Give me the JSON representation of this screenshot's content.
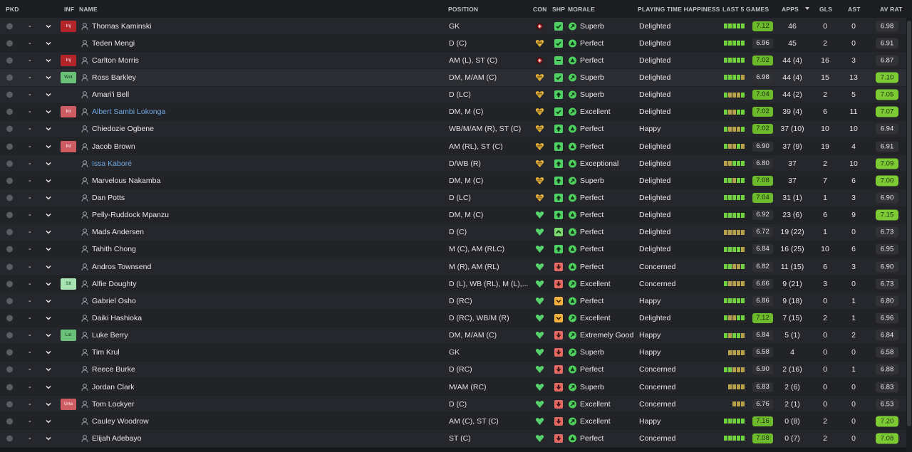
{
  "headers": {
    "pkd": "PKD",
    "inf": "INF",
    "name": "NAME",
    "position": "POSITION",
    "con": "CON",
    "shp": "SHP",
    "morale": "MORALE",
    "pth": "PLAYING TIME HAPPINESS",
    "last5": "LAST 5 GAMES",
    "apps": "APPS",
    "gls": "GLS",
    "ast": "AST",
    "avrat": "AV RAT"
  },
  "colors": {
    "last5_green": "#71d23f",
    "last5_olive": "#b7a04a",
    "last5_gray": "#666870",
    "rating_green": "#7ccb35",
    "con_heart": "#55d26b",
    "con_warn": "#e5b23c",
    "con_injury": "#d4363a"
  },
  "players": [
    {
      "pkd": "-",
      "inf": "Inj",
      "inf_style": "red",
      "name": "Thomas Kaminski",
      "name_style": "",
      "position": "GK",
      "con": "injury",
      "shp": "tick",
      "morale_icon": "arrow",
      "morale": "Superb",
      "pth": "Delighted",
      "last5": [
        "g",
        "g",
        "g",
        "g",
        "g"
      ],
      "avg": "7.12",
      "avg_style": "hi",
      "apps": "46",
      "gls": "0",
      "ast": "0",
      "avrat": "6.98",
      "avrat_style": "mid"
    },
    {
      "pkd": "-",
      "inf": "",
      "inf_style": "",
      "name": "Teden Mengi",
      "name_style": "",
      "position": "D (C)",
      "con": "warn",
      "shp": "tick",
      "morale_icon": "up",
      "morale": "Perfect",
      "pth": "Delighted",
      "last5": [
        "g",
        "g",
        "g",
        "g",
        "g"
      ],
      "avg": "6.96",
      "avg_style": "mid",
      "apps": "45",
      "gls": "2",
      "ast": "0",
      "avrat": "6.91",
      "avrat_style": "mid"
    },
    {
      "pkd": "-",
      "inf": "Inj",
      "inf_style": "red",
      "name": "Carlton Morris",
      "name_style": "",
      "position": "AM (L), ST (C)",
      "con": "injury",
      "shp": "dash",
      "morale_icon": "up",
      "morale": "Perfect",
      "pth": "Delighted",
      "last5": [
        "g",
        "g",
        "g",
        "g",
        "g"
      ],
      "avg": "7.02",
      "avg_style": "hi",
      "apps": "44 (4)",
      "gls": "16",
      "ast": "3",
      "avrat": "6.87",
      "avrat_style": "mid"
    },
    {
      "pkd": "-",
      "inf": "Wnt",
      "inf_style": "green",
      "name": "Ross Barkley",
      "name_style": "",
      "position": "DM, M/AM (C)",
      "con": "warn",
      "shp": "tick",
      "morale_icon": "arrow",
      "morale": "Superb",
      "pth": "Delighted",
      "last5": [
        "g",
        "g",
        "g",
        "g",
        "o"
      ],
      "avg": "6.98",
      "avg_style": "mid",
      "apps": "44 (4)",
      "gls": "15",
      "ast": "13",
      "avrat": "7.10",
      "avrat_style": "hi"
    },
    {
      "pkd": "-",
      "inf": "",
      "inf_style": "",
      "name": "Amari'i Bell",
      "name_style": "",
      "position": "D (LC)",
      "con": "warn",
      "shp": "up",
      "morale_icon": "arrow",
      "morale": "Superb",
      "pth": "Delighted",
      "last5": [
        "g",
        "o",
        "o",
        "o",
        "g"
      ],
      "avg": "7.04",
      "avg_style": "hi",
      "apps": "44 (2)",
      "gls": "2",
      "ast": "5",
      "avrat": "7.05",
      "avrat_style": "hi"
    },
    {
      "pkd": "-",
      "inf": "Int",
      "inf_style": "pink",
      "name": "Albert Sambi Lokonga",
      "name_style": "blue",
      "position": "DM, M (C)",
      "con": "warn",
      "shp": "tick",
      "morale_icon": "arrow",
      "morale": "Excellent",
      "pth": "Delighted",
      "last5": [
        "g",
        "o",
        "o",
        "g",
        "g"
      ],
      "avg": "7.02",
      "avg_style": "hi",
      "apps": "39 (4)",
      "gls": "6",
      "ast": "11",
      "avrat": "7.07",
      "avrat_style": "hi"
    },
    {
      "pkd": "-",
      "inf": "",
      "inf_style": "",
      "name": "Chiedozie Ogbene",
      "name_style": "",
      "position": "WB/M/AM (R), ST (C)",
      "con": "warn",
      "shp": "up",
      "morale_icon": "up",
      "morale": "Perfect",
      "pth": "Happy",
      "last5": [
        "g",
        "o",
        "o",
        "o",
        "g"
      ],
      "avg": "7.02",
      "avg_style": "hi",
      "apps": "37 (10)",
      "gls": "10",
      "ast": "10",
      "avrat": "6.94",
      "avrat_style": "mid"
    },
    {
      "pkd": "-",
      "inf": "Int",
      "inf_style": "pink",
      "name": "Jacob Brown",
      "name_style": "",
      "position": "AM (RL), ST (C)",
      "con": "warn",
      "shp": "up",
      "morale_icon": "up",
      "morale": "Perfect",
      "pth": "Delighted",
      "last5": [
        "g",
        "o",
        "o",
        "g",
        "o"
      ],
      "avg": "6.90",
      "avg_style": "mid",
      "apps": "37 (9)",
      "gls": "19",
      "ast": "4",
      "avrat": "6.91",
      "avrat_style": "mid"
    },
    {
      "pkd": "-",
      "inf": "",
      "inf_style": "",
      "name": "Issa Kaboré",
      "name_style": "blue",
      "position": "D/WB (R)",
      "con": "warn",
      "shp": "up",
      "morale_icon": "up",
      "morale": "Exceptional",
      "pth": "Delighted",
      "last5": [
        "o",
        "o",
        "g",
        "g",
        "g"
      ],
      "avg": "6.80",
      "avg_style": "mid",
      "apps": "37",
      "gls": "2",
      "ast": "10",
      "avrat": "7.09",
      "avrat_style": "hi"
    },
    {
      "pkd": "-",
      "inf": "",
      "inf_style": "",
      "name": "Marvelous Nakamba",
      "name_style": "",
      "position": "DM, M (C)",
      "con": "warn",
      "shp": "up",
      "morale_icon": "arrow",
      "morale": "Superb",
      "pth": "Delighted",
      "last5": [
        "g",
        "g",
        "o",
        "g",
        "g"
      ],
      "avg": "7.08",
      "avg_style": "hi",
      "apps": "37",
      "gls": "7",
      "ast": "6",
      "avrat": "7.00",
      "avrat_style": "hi"
    },
    {
      "pkd": "-",
      "inf": "",
      "inf_style": "",
      "name": "Dan Potts",
      "name_style": "",
      "position": "D (LC)",
      "con": "warn",
      "shp": "up",
      "morale_icon": "up",
      "morale": "Perfect",
      "pth": "Delighted",
      "last5": [
        "g",
        "g",
        "g",
        "g",
        "g"
      ],
      "avg": "7.04",
      "avg_style": "hi",
      "apps": "31 (1)",
      "gls": "1",
      "ast": "3",
      "avrat": "6.90",
      "avrat_style": "mid"
    },
    {
      "pkd": "-",
      "inf": "",
      "inf_style": "",
      "name": "Pelly-Ruddock Mpanzu",
      "name_style": "",
      "position": "DM, M (C)",
      "con": "heart",
      "shp": "up",
      "morale_icon": "up",
      "morale": "Perfect",
      "pth": "Delighted",
      "last5": [
        "g",
        "g",
        "g",
        "g",
        "g"
      ],
      "avg": "6.92",
      "avg_style": "mid",
      "apps": "23 (6)",
      "gls": "6",
      "ast": "9",
      "avrat": "7.15",
      "avrat_style": "hi"
    },
    {
      "pkd": "-",
      "inf": "",
      "inf_style": "",
      "name": "Mads Andersen",
      "name_style": "",
      "position": "D (C)",
      "con": "heart",
      "shp": "caret",
      "morale_icon": "up",
      "morale": "Perfect",
      "pth": "Delighted",
      "last5": [
        "o",
        "o",
        "o",
        "o",
        "o"
      ],
      "avg": "6.72",
      "avg_style": "mid",
      "apps": "19 (22)",
      "gls": "1",
      "ast": "0",
      "avrat": "6.73",
      "avrat_style": "mid"
    },
    {
      "pkd": "-",
      "inf": "",
      "inf_style": "",
      "name": "Tahith Chong",
      "name_style": "",
      "position": "M (C), AM (RLC)",
      "con": "heart",
      "shp": "up",
      "morale_icon": "up",
      "morale": "Perfect",
      "pth": "Delighted",
      "last5": [
        "g",
        "g",
        "g",
        "g",
        "o"
      ],
      "avg": "6.84",
      "avg_style": "mid",
      "apps": "16 (25)",
      "gls": "10",
      "ast": "6",
      "avrat": "6.95",
      "avrat_style": "mid"
    },
    {
      "pkd": "-",
      "inf": "",
      "inf_style": "",
      "name": "Andros Townsend",
      "name_style": "",
      "position": "M (R), AM (RL)",
      "con": "heart",
      "shp": "down",
      "morale_icon": "up",
      "morale": "Perfect",
      "pth": "Concerned",
      "last5": [
        "g",
        "g",
        "o",
        "o",
        "g"
      ],
      "avg": "6.82",
      "avg_style": "mid",
      "apps": "11 (15)",
      "gls": "6",
      "ast": "3",
      "avrat": "6.90",
      "avrat_style": "mid"
    },
    {
      "pkd": "-",
      "inf": "Slt",
      "inf_style": "mint",
      "name": "Alfie Doughty",
      "name_style": "",
      "position": "D (L), WB (RL), M (L),...",
      "con": "heart",
      "shp": "down",
      "morale_icon": "arrow",
      "morale": "Excellent",
      "pth": "Concerned",
      "last5": [
        "g",
        "o",
        "o",
        "o",
        "o"
      ],
      "avg": "6.66",
      "avg_style": "mid",
      "apps": "9 (21)",
      "gls": "3",
      "ast": "0",
      "avrat": "6.73",
      "avrat_style": "mid"
    },
    {
      "pkd": "-",
      "inf": "",
      "inf_style": "",
      "name": "Gabriel Osho",
      "name_style": "",
      "position": "D (RC)",
      "con": "heart",
      "shp": "vdown",
      "morale_icon": "up",
      "morale": "Perfect",
      "pth": "Happy",
      "last5": [
        "g",
        "g",
        "g",
        "g",
        "g"
      ],
      "avg": "6.86",
      "avg_style": "mid",
      "apps": "9 (18)",
      "gls": "0",
      "ast": "1",
      "avrat": "6.80",
      "avrat_style": "mid"
    },
    {
      "pkd": "-",
      "inf": "",
      "inf_style": "",
      "name": "Daiki Hashioka",
      "name_style": "",
      "position": "D (RC), WB/M (R)",
      "con": "heart",
      "shp": "vdown",
      "morale_icon": "arrow",
      "morale": "Excellent",
      "pth": "Delighted",
      "last5": [
        "g",
        "o",
        "o",
        "g",
        "g"
      ],
      "avg": "7.12",
      "avg_style": "hi",
      "apps": "7 (15)",
      "gls": "2",
      "ast": "1",
      "avrat": "6.96",
      "avrat_style": "mid"
    },
    {
      "pkd": "-",
      "inf": "Lst",
      "inf_style": "green",
      "name": "Luke Berry",
      "name_style": "",
      "position": "DM, M/AM (C)",
      "con": "heart",
      "shp": "down",
      "morale_icon": "arrow",
      "morale": "Extremely Good",
      "pth": "Happy",
      "last5": [
        "g",
        "o",
        "g",
        "g",
        "o"
      ],
      "avg": "6.84",
      "avg_style": "mid",
      "apps": "5 (1)",
      "gls": "0",
      "ast": "2",
      "avrat": "6.84",
      "avrat_style": "mid"
    },
    {
      "pkd": "-",
      "inf": "",
      "inf_style": "",
      "name": "Tim Krul",
      "name_style": "",
      "position": "GK",
      "con": "heart",
      "shp": "down",
      "morale_icon": "arrow",
      "morale": "Superb",
      "pth": "Happy",
      "last5": [
        "o",
        "o",
        "o",
        "o"
      ],
      "avg": "6.58",
      "avg_style": "mid",
      "apps": "4",
      "gls": "0",
      "ast": "0",
      "avrat": "6.58",
      "avrat_style": "mid"
    },
    {
      "pkd": "-",
      "inf": "",
      "inf_style": "",
      "name": "Reece Burke",
      "name_style": "",
      "position": "D (RC)",
      "con": "heart",
      "shp": "down",
      "morale_icon": "up",
      "morale": "Perfect",
      "pth": "Concerned",
      "last5": [
        "g",
        "g",
        "o",
        "o",
        "o"
      ],
      "avg": "6.90",
      "avg_style": "mid",
      "apps": "2 (16)",
      "gls": "0",
      "ast": "1",
      "avrat": "6.88",
      "avrat_style": "mid"
    },
    {
      "pkd": "-",
      "inf": "",
      "inf_style": "",
      "name": "Jordan Clark",
      "name_style": "",
      "position": "M/AM (RC)",
      "con": "heart",
      "shp": "down",
      "morale_icon": "arrow",
      "morale": "Superb",
      "pth": "Concerned",
      "last5": [
        "o",
        "o",
        "o",
        "o"
      ],
      "avg": "6.83",
      "avg_style": "mid",
      "apps": "2 (6)",
      "gls": "0",
      "ast": "0",
      "avrat": "6.83",
      "avrat_style": "mid"
    },
    {
      "pkd": "-",
      "inf": "Una",
      "inf_style": "pink",
      "name": "Tom Lockyer",
      "name_style": "",
      "position": "D (C)",
      "con": "heart",
      "shp": "down",
      "morale_icon": "arrow",
      "morale": "Excellent",
      "pth": "Concerned",
      "last5": [
        "o",
        "o",
        "o"
      ],
      "avg": "6.76",
      "avg_style": "mid",
      "apps": "2 (1)",
      "gls": "0",
      "ast": "0",
      "avrat": "6.53",
      "avrat_style": "mid"
    },
    {
      "pkd": "-",
      "inf": "",
      "inf_style": "",
      "name": "Cauley Woodrow",
      "name_style": "",
      "position": "AM (C), ST (C)",
      "con": "heart",
      "shp": "down",
      "morale_icon": "arrow",
      "morale": "Excellent",
      "pth": "Happy",
      "last5": [
        "g",
        "g",
        "g",
        "g",
        "g"
      ],
      "avg": "7.16",
      "avg_style": "hi",
      "apps": "0 (8)",
      "gls": "2",
      "ast": "0",
      "avrat": "7.20",
      "avrat_style": "hi"
    },
    {
      "pkd": "-",
      "inf": "",
      "inf_style": "",
      "name": "Elijah Adebayo",
      "name_style": "",
      "position": "ST (C)",
      "con": "heart",
      "shp": "down",
      "morale_icon": "up",
      "morale": "Perfect",
      "pth": "Concerned",
      "last5": [
        "g",
        "g",
        "g",
        "g",
        "g"
      ],
      "avg": "7.08",
      "avg_style": "hi",
      "apps": "0 (7)",
      "gls": "2",
      "ast": "0",
      "avrat": "7.08",
      "avrat_style": "hi"
    }
  ]
}
